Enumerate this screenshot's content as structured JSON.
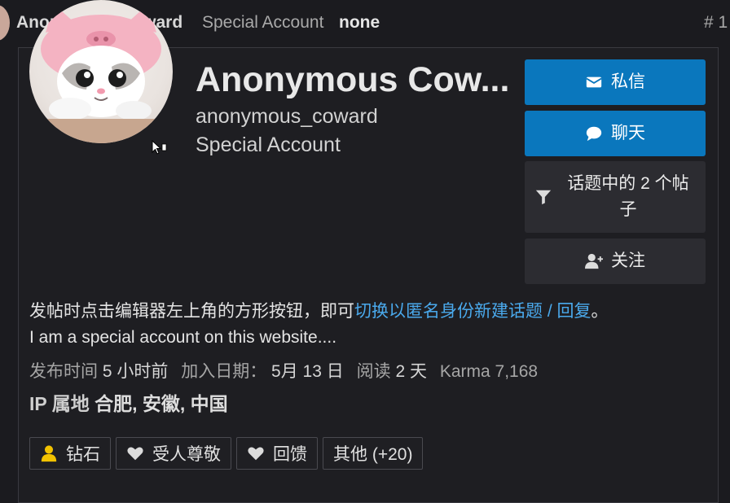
{
  "post_header": {
    "username": "Anonymous Coward",
    "user_title": "Special Account",
    "flair": "none",
    "post_number": "# 1"
  },
  "profile": {
    "display_name": "Anonymous Cow...",
    "username": "anonymous_coward",
    "title": "Special Account"
  },
  "actions": {
    "message": "私信",
    "chat": "聊天",
    "filter": "话题中的 2 个帖子",
    "follow": "关注"
  },
  "bio": {
    "line1_prefix": "发帖时点击编辑器左上角的方形按钮，即可",
    "line1_link": "切换以匿名身份新建话题 / 回复",
    "line1_suffix": "。",
    "line2": "I am a special account on this website...."
  },
  "meta": {
    "posted_label": "发布时间",
    "posted_value": "5 小时前",
    "joined_label": "加入日期：",
    "joined_value": "5月 13 日",
    "read_label": "阅读",
    "read_value": "2 天",
    "karma_label": "Karma",
    "karma_value": "7,168"
  },
  "ip": {
    "label": "IP 属地",
    "value": "合肥, 安徽, 中国"
  },
  "badges": [
    {
      "label": "钻石",
      "icon": "user-icon",
      "color": "#f2c200"
    },
    {
      "label": "受人尊敬",
      "icon": "heart-icon",
      "color": "#dcdcdc"
    },
    {
      "label": "回馈",
      "icon": "heart-icon",
      "color": "#dcdcdc"
    },
    {
      "label": "其他 (+20)",
      "icon": "",
      "color": "#dcdcdc"
    }
  ],
  "colors": {
    "primary_button": "#0a77bd",
    "link": "#4aa9ec",
    "badge_gold": "#f2c200"
  }
}
